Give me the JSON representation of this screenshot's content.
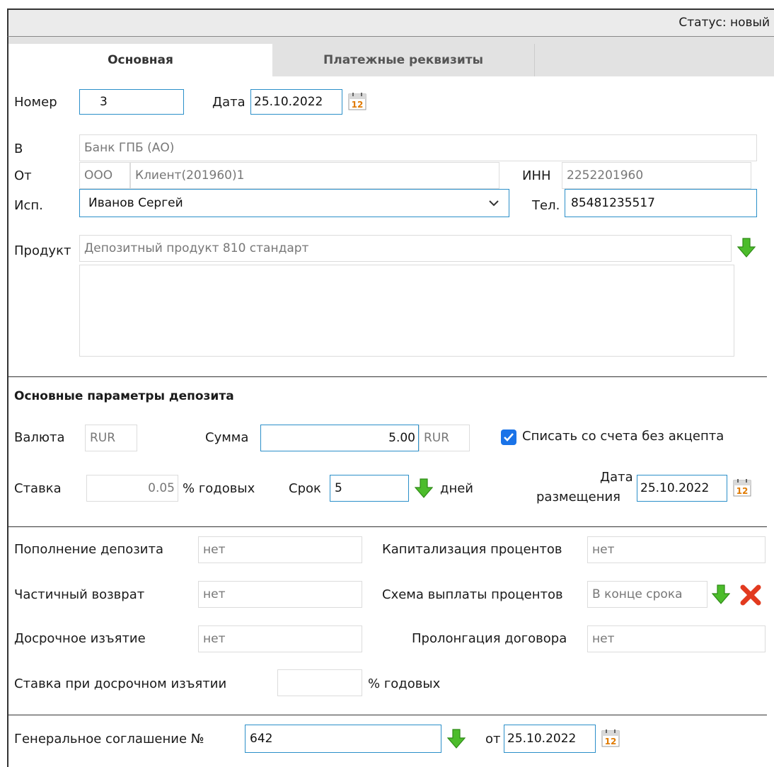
{
  "status": "Статус: новый",
  "tabs": {
    "main": "Основная",
    "payment": "Платежные реквизиты"
  },
  "form": {
    "number_label": "Номер",
    "number": "3",
    "date_label": "Дата",
    "date": "25.10.2022",
    "to_label": "В",
    "to": "Банк ГПБ (АО)",
    "from_label": "От",
    "from_type": "ООО",
    "from_name": "Клиент(201960)1",
    "inn_label": "ИНН",
    "inn": "2252201960",
    "exec_label": "Исп.",
    "exec": "Иванов Сергей",
    "phone_label": "Тел.",
    "phone": "85481235517",
    "product_label": "Продукт",
    "product": "Депозитный продукт 810 стандарт"
  },
  "params": {
    "heading": "Основные параметры депозита",
    "currency_label": "Валюта",
    "currency": "RUR",
    "sum_label": "Сумма",
    "sum": "5.00",
    "sum_currency": "RUR",
    "writeoff_label": "Списать со счета без акцепта",
    "rate_label": "Ставка",
    "rate": "0.05",
    "rate_unit": "% годовых",
    "term_label": "Срок",
    "term": "5",
    "term_unit": "дней",
    "place_date_label1": "Дата",
    "place_date_label2": "размещения",
    "place_date": "25.10.2022"
  },
  "options": {
    "refill_label": "Пополнение депозита",
    "refill": "нет",
    "cap_label": "Капитализация процентов",
    "cap": "нет",
    "partial_label": "Частичный возврат",
    "partial": "нет",
    "scheme_label": "Схема выплаты процентов",
    "scheme": "В конце срока",
    "early_label": "Досрочное изъятие",
    "early": "нет",
    "prolong_label": "Пролонгация договора",
    "prolong": "нет",
    "early_rate_label": "Ставка при досрочном изъятии",
    "early_rate": "",
    "early_rate_unit": "% годовых"
  },
  "agreement": {
    "label": "Генеральное соглашение №",
    "number": "642",
    "from_label": "от",
    "date": "25.10.2022"
  },
  "icons": {
    "calendar": "calendar-icon",
    "arrow": "green-down-arrow-icon",
    "delete": "red-x-icon",
    "checkbox": "checkbox-checked-icon"
  }
}
